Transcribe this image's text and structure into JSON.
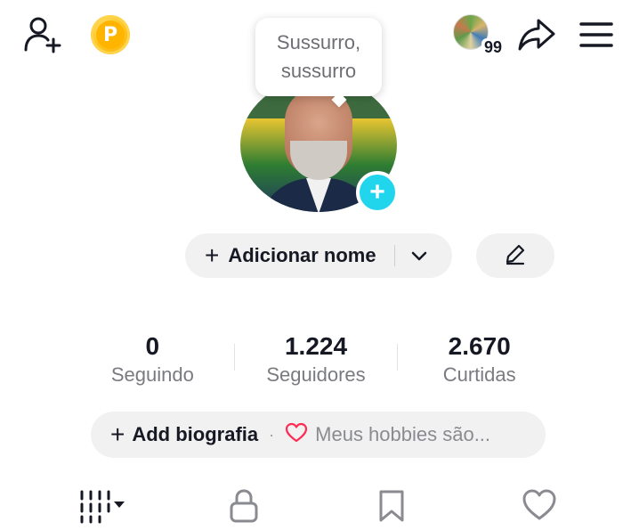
{
  "topbar": {
    "add_friend_icon": "person-plus-icon",
    "points_icon": "coin-p-icon",
    "points_letter": "P",
    "visitor_count": "99",
    "share_icon": "share-arrow-icon",
    "menu_icon": "hamburger-menu-icon"
  },
  "bubble": {
    "text": "Sussurro, sussurro"
  },
  "profile": {
    "add_name_label": "Adicionar nome",
    "plus": "+"
  },
  "stats": [
    {
      "value": "0",
      "label": "Seguindo"
    },
    {
      "value": "1.224",
      "label": "Seguidores"
    },
    {
      "value": "2.670",
      "label": "Curtidas"
    }
  ],
  "bio": {
    "add_label": "Add biografia",
    "dot": "·",
    "hobbies_label": "Meus hobbies são..."
  },
  "tabs": [
    {
      "name": "videos-tab",
      "icon": "grid-icon"
    },
    {
      "name": "private-tab",
      "icon": "lock-icon"
    },
    {
      "name": "saved-tab",
      "icon": "bookmark-icon"
    },
    {
      "name": "liked-tab",
      "icon": "heart-icon"
    }
  ],
  "colors": {
    "accent": "#20d5ec",
    "heart": "#fe2c55",
    "pill_bg": "#f1f1f2",
    "muted_text": "#7a7b80"
  }
}
